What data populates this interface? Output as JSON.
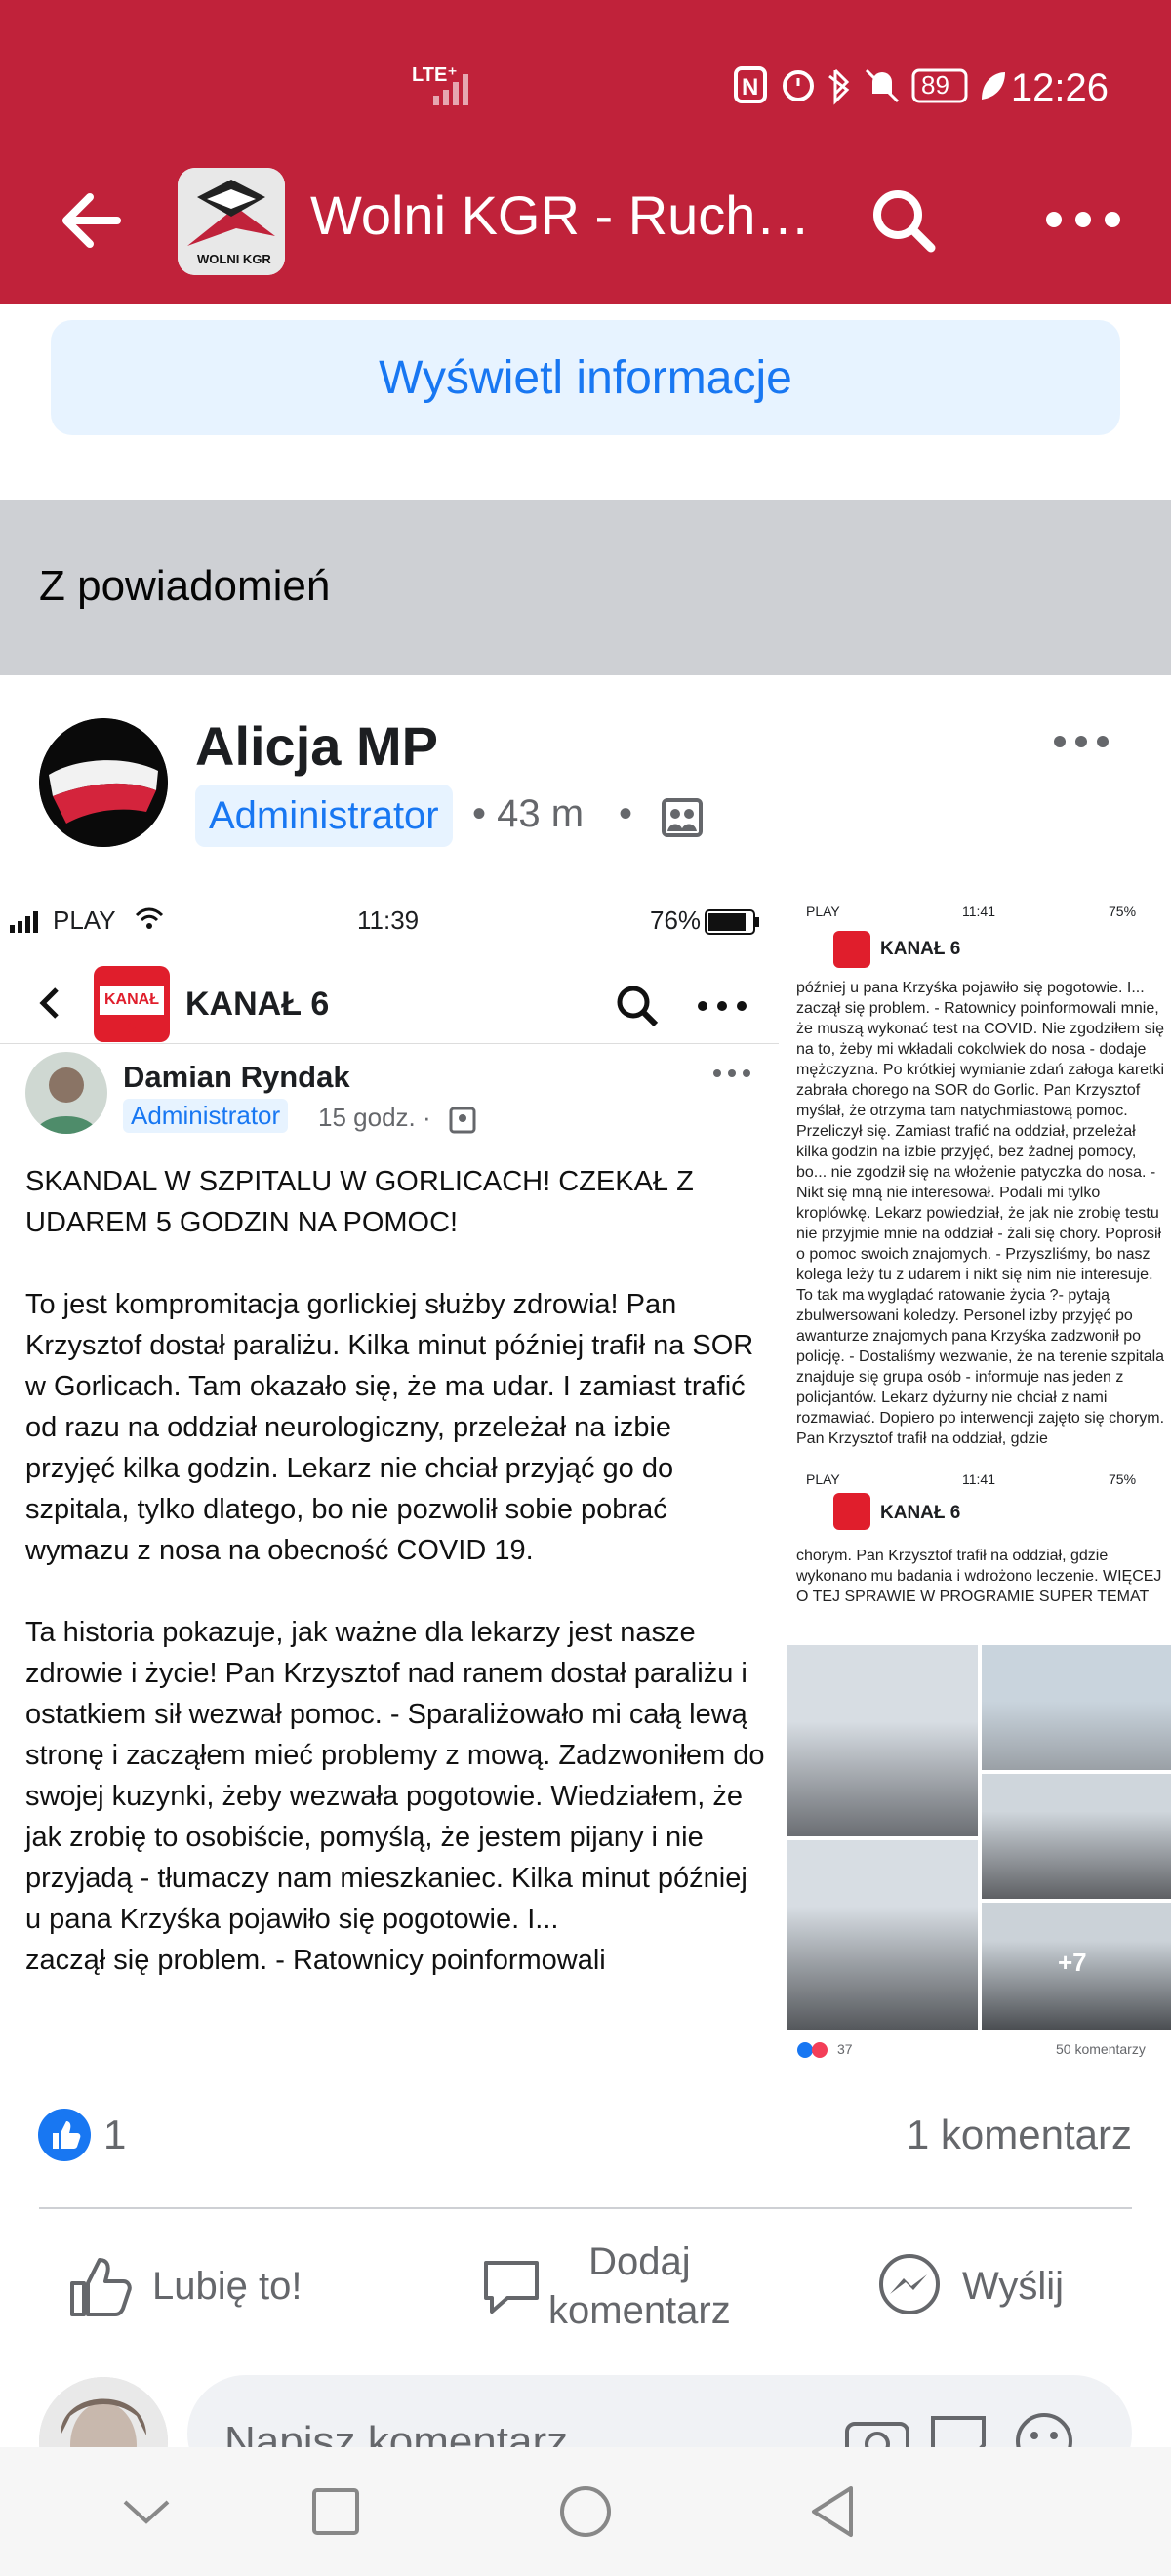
{
  "status_bar": {
    "network": "LTE⁺",
    "battery": "89",
    "time": "12:26"
  },
  "app_bar": {
    "title": "Wolni KGR - Ruch…",
    "logo_text": "WOLNI KGR"
  },
  "info_button": {
    "label": "Wyświetl informacje"
  },
  "section": {
    "label": "Z powiadomień"
  },
  "post": {
    "author": "Alicja MP",
    "role": "Administrator",
    "time": "• 43 m",
    "dot": "•"
  },
  "embedded": {
    "status": {
      "carrier": "PLAY",
      "time": "11:39",
      "battery": "76%"
    },
    "page_name": "KANAŁ 6",
    "page_logo": "KANAŁ 6",
    "author": "Damian Ryndak",
    "role": "Administrator",
    "time": "15 godz. ·",
    "text": "SKANDAL W SZPITALU W GORLICACH! CZEKAŁ Z UDAREM 5 GODZIN NA POMOC!\n\nTo jest kompromitacja gorlickiej służby zdrowia! Pan Krzysztof dostał paraliżu. Kilka minut później trafił na SOR w Gorlicach. Tam okazało się, że ma udar. I zamiast trafić od razu na oddział neurologiczny, przeleżał na izbie przyjęć kilka godzin. Lekarz nie chciał przyjąć go do szpitala, tylko dlatego, bo nie pozwolił sobie pobrać wymazu z nosa na obecność COVID 19.\n\nTa historia pokazuje, jak ważne dla lekarzy jest nasze zdrowie i życie! Pan Krzysztof nad ranem dostał paraliżu i ostatkiem sił wezwał pomoc. - Sparaliżowało mi całą lewą stronę i zacząłem mieć problemy z mową. Zadzwoniłem do swojej kuzynki, żeby wezwała pogotowie. Wiedziałem, że jak zrobię to osobiście, pomyślą, że jestem pijany i nie przyjadą - tłumaczy nam mieszkaniec. Kilka minut później u pana Krzyśka pojawiło się pogotowie. I...\nzaczął się problem. - Ratownicy poinformowali",
    "right_top": {
      "status": {
        "carrier": "PLAY",
        "time": "11:41",
        "battery": "75%"
      },
      "page_name": "KANAŁ 6",
      "text": "później u pana Krzyśka pojawiło się pogotowie. I... zaczął się problem. - Ratownicy poinformowali mnie, że muszą wykonać test na COVID. Nie zgodziłem się na to, żeby mi wkładali cokolwiek do nosa - dodaje mężczyzna. Po krótkiej wymianie zdań załoga karetki zabrała chorego na SOR do Gorlic. Pan Krzysztof myślał, że otrzyma tam natychmiastową pomoc. Przeliczył się. Zamiast trafić na oddział, przeleżał kilka godzin na izbie przyjęć, bez żadnej pomocy, bo... nie zgodził się na włożenie patyczka do nosa. - Nikt się mną nie interesował. Podali mi tylko kroplówkę. Lekarz powiedział, że jak nie zrobię testu nie przyjmie mnie na oddział - żali się chory. Poprosił o pomoc swoich znajomych. - Przyszliśmy, bo nasz kolega leży tu z udarem i nikt się nim nie interesuje. To tak ma wyglądać ratowanie życia ?- pytają zbulwersowani koledzy. Personel izby przyjęć po awanturze znajomych pana Krzyśka zadzwonił po policję. - Dostaliśmy wezwanie, że na terenie szpitala znajduje się grupa osób - informuje nas jeden z policjantów. Lekarz dyżurny nie chciał z nami rozmawiać. Dopiero po interwencji zajęto się chorym. Pan Krzysztof trafił na oddział, gdzie"
    },
    "right_bottom": {
      "status": {
        "carrier": "PLAY",
        "time": "11:41",
        "battery": "75%"
      },
      "page_name": "KANAŁ 6",
      "text": "chorym. Pan Krzysztof trafił na oddział, gdzie wykonano mu badania i wdrożono leczenie. WIĘCEJ O TEJ SPRAWIE W PROGRAMIE SUPER TEMAT",
      "more_photos": "+7",
      "reactions_count": "37",
      "comments": "50 komentarzy"
    }
  },
  "reactions": {
    "likes": "1",
    "comments": "1 komentarz"
  },
  "actions": {
    "like": "Lubię to!",
    "comment_line1": "Dodaj",
    "comment_line2": "komentarz",
    "send": "Wyślij"
  },
  "composer": {
    "placeholder": "Napisz komentarz..."
  },
  "colors": {
    "brand_red": "#c0223a",
    "fb_blue": "#1877f2",
    "grey_section": "#ced0d4"
  }
}
